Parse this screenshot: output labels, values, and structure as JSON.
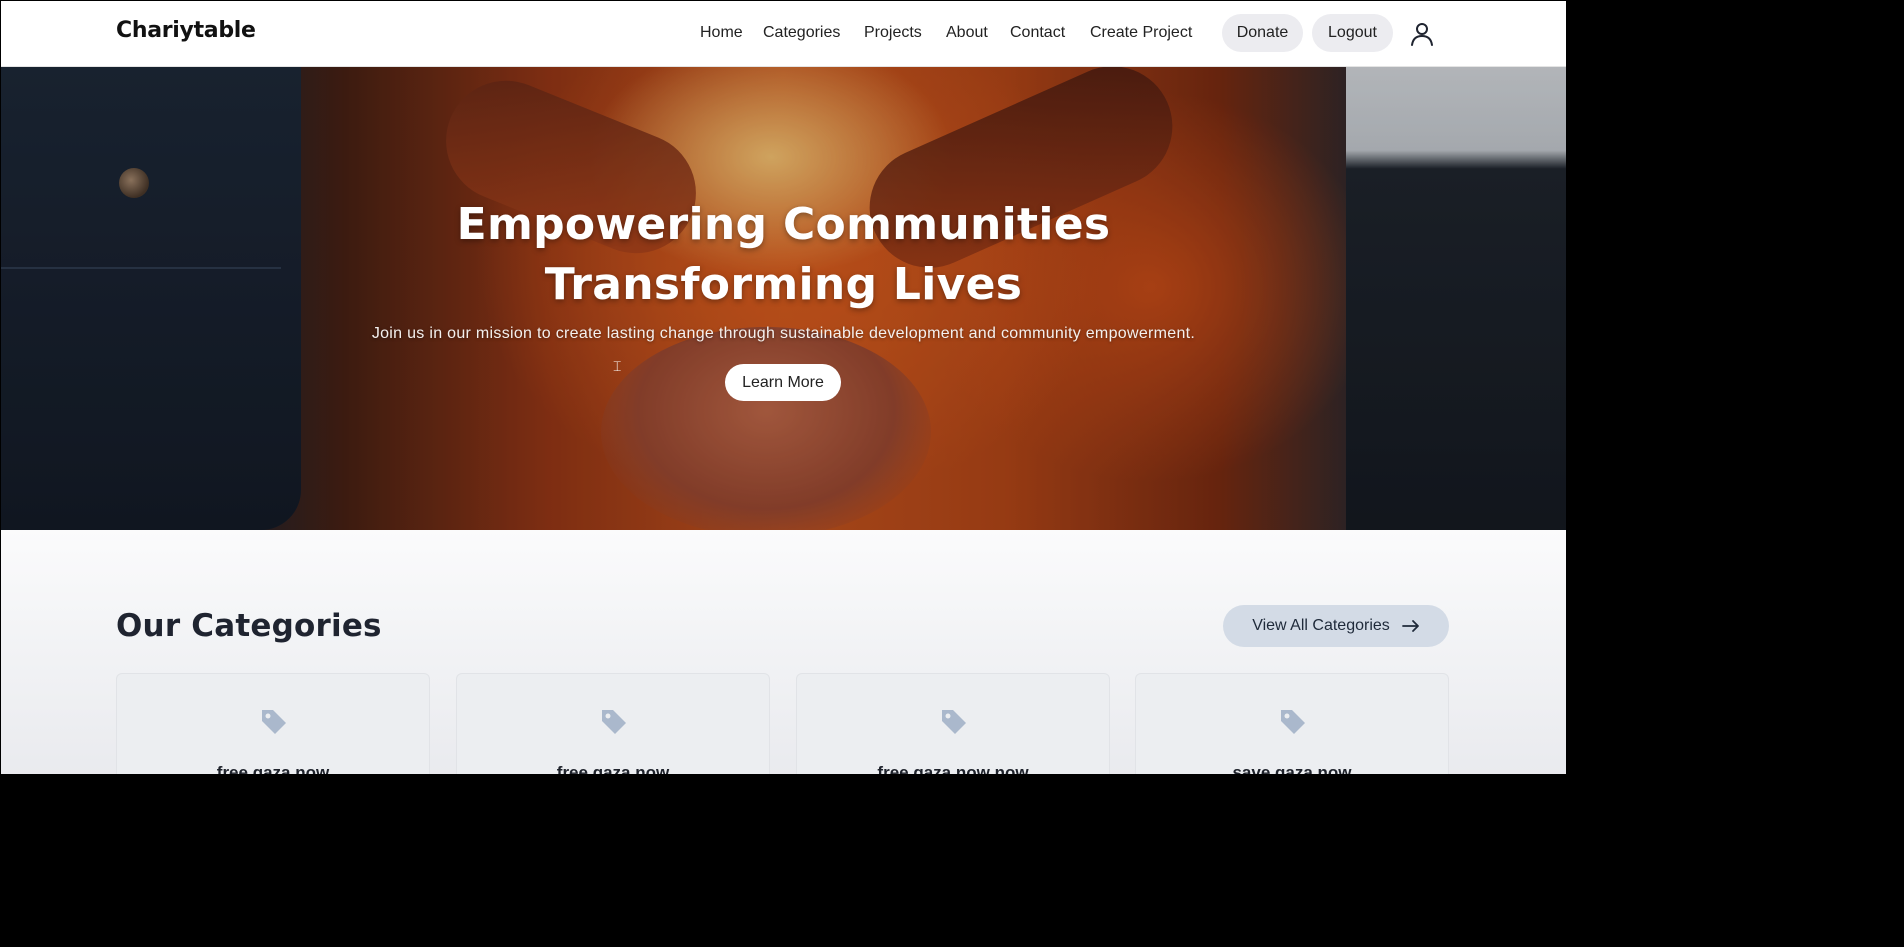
{
  "navbar": {
    "brand": "Chariytable",
    "links": [
      "Home",
      "Categories",
      "Projects",
      "About",
      "Contact",
      "Create Project"
    ],
    "donate_label": "Donate",
    "logout_label": "Logout",
    "user_icon": "user-icon"
  },
  "hero": {
    "title_line1": "Empowering Communities",
    "title_line2": "Transforming Lives",
    "subtitle": "Join us in our mission to create lasting change through sustainable development and community empowerment.",
    "cta_label": "Learn More"
  },
  "categories": {
    "heading": "Our Categories",
    "view_all_label": "View All Categories",
    "view_all_icon": "arrow-right-icon",
    "items": [
      {
        "name": "free gaza now",
        "icon": "tag-icon"
      },
      {
        "name": "free gaza now",
        "icon": "tag-icon"
      },
      {
        "name": "free gaza now now",
        "icon": "tag-icon"
      },
      {
        "name": "save gaza now",
        "icon": "tag-icon"
      }
    ]
  },
  "colors": {
    "pill_bg": "#ececf0",
    "view_all_bg": "#d3dbe6",
    "tag_icon": "#aab8cc"
  }
}
